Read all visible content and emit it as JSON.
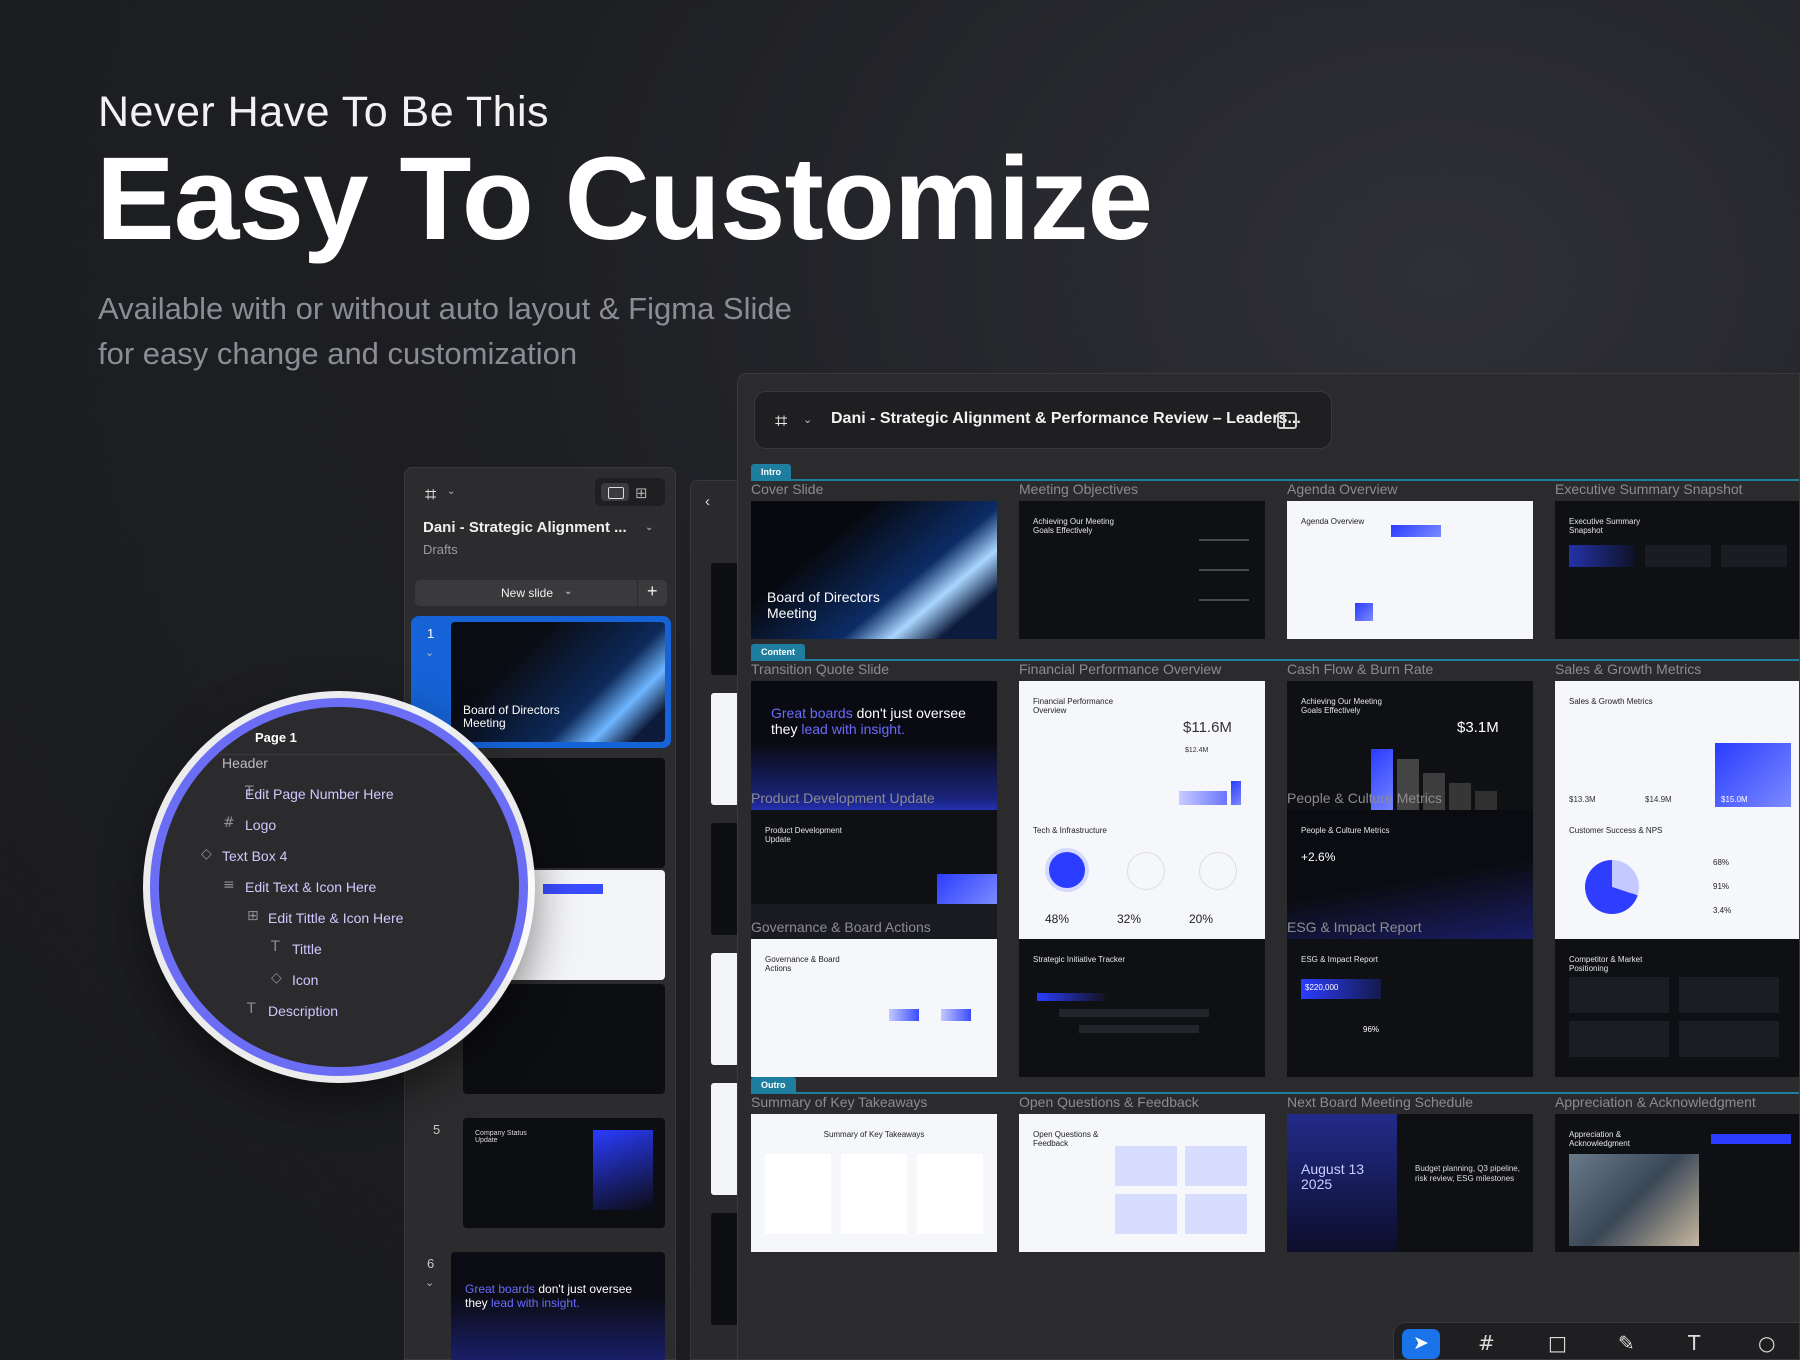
{
  "hero": {
    "eyebrow": "Never Have To Be This",
    "title": "Easy To Customize",
    "subtitle_line1": "Available with or without auto layout  & Figma Slide",
    "subtitle_line2": "for easy change and customization"
  },
  "main_window": {
    "title": "Dani - Strategic Alignment & Performance Review – Leaders...",
    "sections": [
      "Intro",
      "Content",
      "Outro"
    ],
    "slide_labels": [
      "Cover Slide",
      "Meeting Objectives",
      "Agenda Overview",
      "Executive Summary Snapshot",
      "Transition Quote Slide",
      "Financial Performance Overview",
      "Cash Flow & Burn Rate",
      "Sales & Growth Metrics",
      "Product Development Update",
      "People & Culture Metrics",
      "Governance & Board Actions",
      "ESG & Impact Report",
      "Summary of Key Takeaways",
      "Open Questions & Feedback",
      "Next Board Meeting Schedule",
      "Appreciation & Acknowledgment"
    ],
    "thumbs": {
      "cover": "Board of Directors Meeting",
      "objectives": "Achieving Our Meeting Goals Effectively",
      "agenda": "Agenda Overview",
      "exec": "Executive Summary Snapshot",
      "quote_a": "Great boards",
      "quote_b": " don't just oversee they ",
      "quote_c": "lead with insight.",
      "financial": "Financial Performance Overview",
      "financial_value": "$11.6M",
      "financial_value2": "$12.4M",
      "cash": "Achieving Our Meeting Goals Effectively",
      "cash_value": "$3.1M",
      "sales": "Sales & Growth Metrics",
      "sales_a": "$13.3M",
      "sales_b": "$14.9M",
      "sales_c": "$15.0M",
      "product": "Product Development Update",
      "tech": "Tech & Infrastructure",
      "tech_a": "48%",
      "tech_b": "32%",
      "tech_c": "20%",
      "people": "People & Culture Metrics",
      "people_value": "+2.6%",
      "customer": "Customer Success & NPS",
      "customer_a": "68%",
      "customer_b": "91%",
      "customer_c": "3.4%",
      "governance": "Governance & Board Actions",
      "initiative": "Strategic Initiative Tracker",
      "esg": "ESG & Impact Report",
      "esg_value": "$220,000",
      "esg_pct": "96%",
      "competitor": "Competitor & Market Positioning",
      "summary": "Summary of Key Takeaways",
      "questions": "Open Questions & Feedback",
      "next_date": "August 13 2025",
      "next_text": "Budget planning, Q3 pipeline, risk review, ESG milestones",
      "appreciation": "Appreciation & Acknowledgment"
    }
  },
  "sidebar": {
    "title": "Dani - Strategic Alignment ...",
    "location": "Drafts",
    "new_slide_label": "New slide",
    "slides": [
      {
        "num": "1",
        "text": "Board of Directors Meeting"
      },
      {
        "num": "5",
        "text": "Company Status Update"
      },
      {
        "num": "6",
        "text_a": "Great boards",
        "text_b": " don't just oversee they ",
        "text_c": "lead with insight."
      }
    ]
  },
  "magnifier": {
    "page": "Page 1",
    "items": [
      "Header",
      "Edit Page Number Here",
      "Logo",
      "Text Box 4",
      "Edit Text & Icon Here",
      "Edit Tittle & Icon Here",
      "Tittle",
      "Icon",
      "Description"
    ]
  },
  "colors": {
    "accent": "#1563d6",
    "section_teal": "#1d7ea0",
    "magnifier_ring": "#6b6ef5",
    "layer_text": "#d3c7ff"
  }
}
